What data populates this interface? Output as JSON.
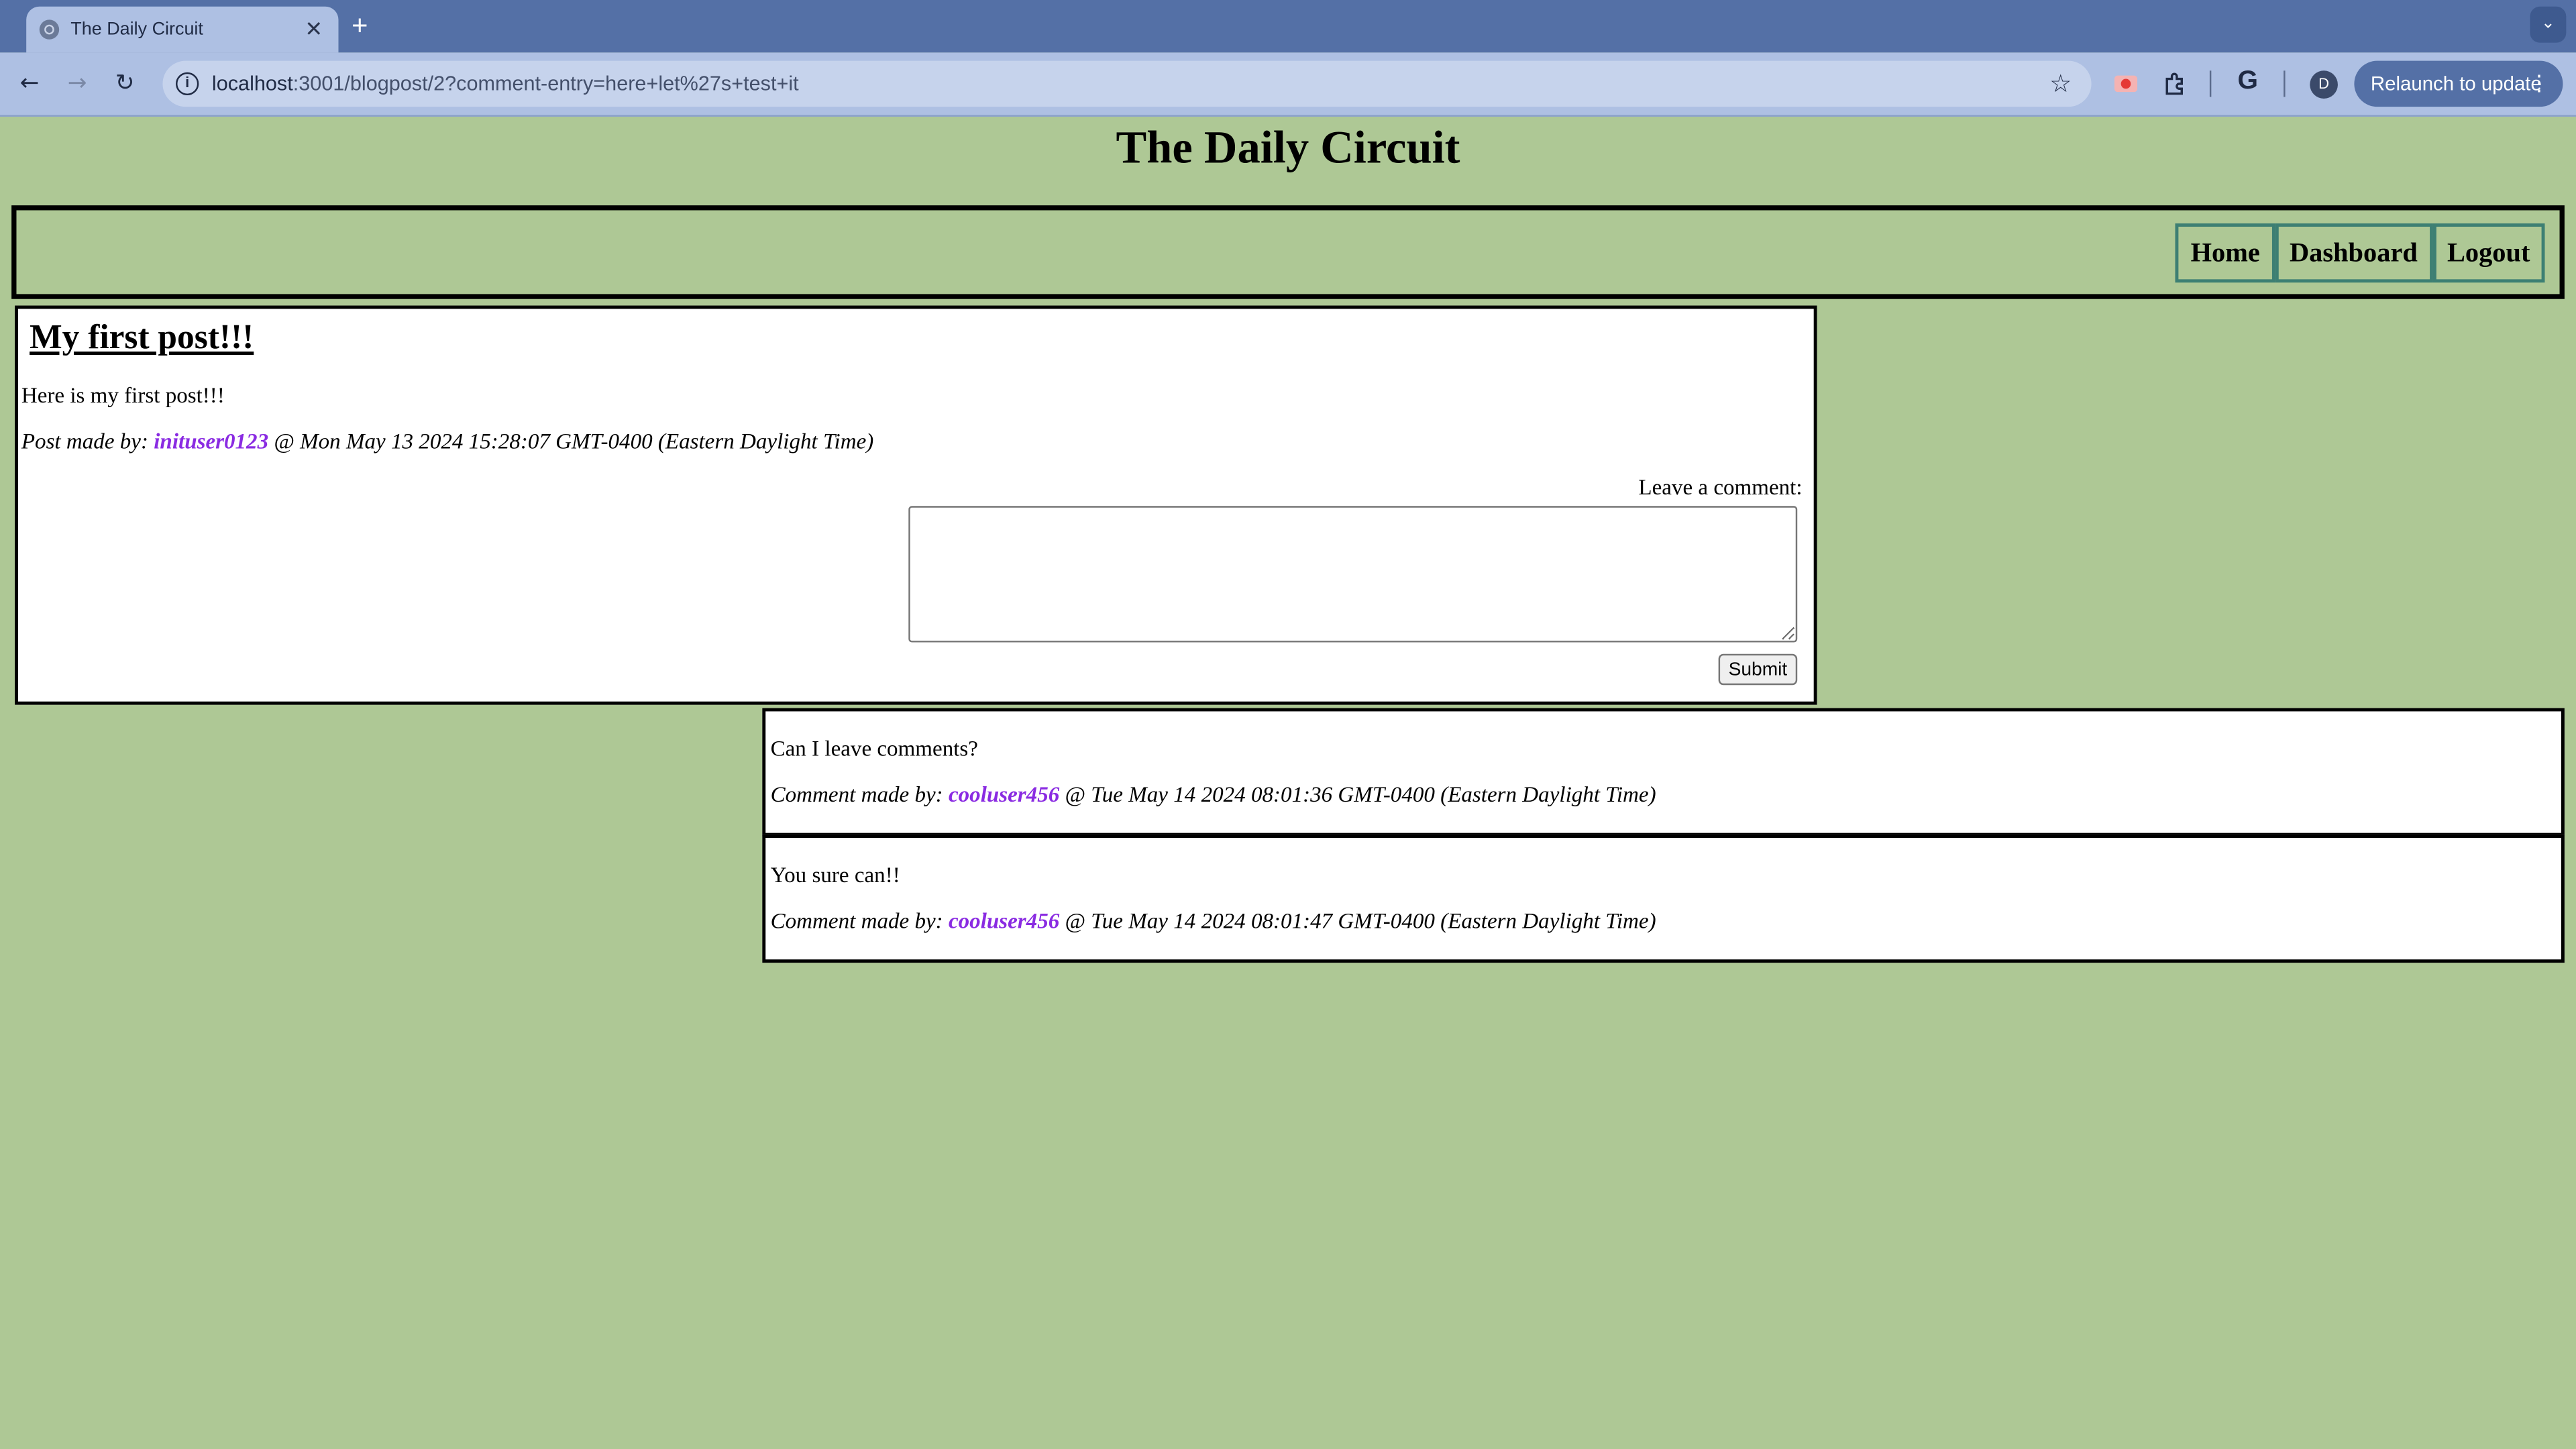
{
  "browser": {
    "tab_title": "The Daily Circuit",
    "tab_close": "✕",
    "new_tab": "+",
    "url_host": "localhost",
    "url_path": ":3001/blogpost/2?comment-entry=here+let%27s+test+it",
    "relaunch_label": "Relaunch to update",
    "avatar_letter": "D"
  },
  "site": {
    "title": "The Daily Circuit",
    "nav": [
      "Home",
      "Dashboard",
      "Logout"
    ]
  },
  "post": {
    "title": "My first post!!!",
    "body": "Here is my first post!!!",
    "meta_prefix": "Post made by: ",
    "author": "inituser0123",
    "meta_suffix": " @ Mon May 13 2024 15:28:07 GMT-0400 (Eastern Daylight Time)"
  },
  "comment_form": {
    "label": "Leave a comment:",
    "value": "",
    "submit_label": "Submit"
  },
  "comments": [
    {
      "text": "Can I leave comments?",
      "meta_prefix": "Comment made by: ",
      "author": "cooluser456",
      "meta_suffix": " @ Tue May 14 2024 08:01:36 GMT-0400 (Eastern Daylight Time)"
    },
    {
      "text": "You sure can!!",
      "meta_prefix": "Comment made by: ",
      "author": "cooluser456",
      "meta_suffix": " @ Tue May 14 2024 08:01:47 GMT-0400 (Eastern Daylight Time)"
    }
  ],
  "colors": {
    "page_background": "#aec895",
    "author_link": "#8a2be2",
    "nav_border": "#3d7f73",
    "tabbar": "#5470a6"
  }
}
